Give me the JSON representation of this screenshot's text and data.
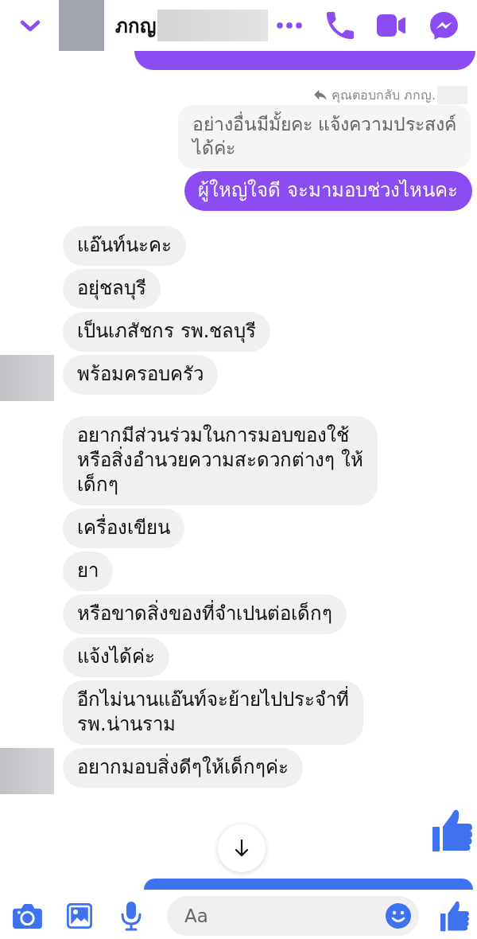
{
  "header": {
    "contact_name": "ภกญ"
  },
  "messages": [
    {
      "kind": "sent",
      "reply_note": "คุณตอบกลับ ภกญ.",
      "quoted_text": "อย่างอื่นมีมั้ยคะ แจ้งความประสงค์\nได้ค่ะ",
      "text": "ผู้ใหญ่ใจดี จะมามอบช่วงไหนคะ"
    },
    {
      "kind": "received",
      "text": "แอ๊นท์นะคะ",
      "avatar": false
    },
    {
      "kind": "received",
      "text": "อยุ่ชลบุรี",
      "avatar": false
    },
    {
      "kind": "received",
      "text": "เป็นเภสัชกร รพ.ชลบุรี",
      "avatar": false
    },
    {
      "kind": "received",
      "text": "พร้อมครอบครัว",
      "avatar": true
    },
    {
      "kind": "received",
      "text": "อยากมีส่วนร่วมในการมอบของใช้\nหรือสิ่งอำนวยความสะดวกต่างๆ ให้\nเด็กๆ",
      "avatar": false
    },
    {
      "kind": "received",
      "text": "เครื่องเขียน",
      "avatar": false
    },
    {
      "kind": "received",
      "text": "ยา",
      "avatar": false
    },
    {
      "kind": "received",
      "text": "หรือขาดสิ่งของที่จำเปนต่อเด็กๆ",
      "avatar": false
    },
    {
      "kind": "received",
      "text": "แจ้งได้ค่ะ",
      "avatar": false
    },
    {
      "kind": "received",
      "text": "อีกไม่นานแอ๊นท์จะย้ายไปประจำที่\nรพ.น่านราม",
      "avatar": false
    },
    {
      "kind": "received",
      "text": "อยากมอบสิ่งดีๆให้เด็กๆค่ะ",
      "avatar": true
    },
    {
      "kind": "like"
    }
  ],
  "composer": {
    "placeholder": "Aa"
  }
}
